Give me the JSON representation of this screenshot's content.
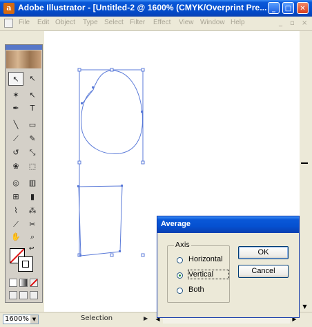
{
  "window": {
    "title": "Adobe Illustrator - [Untitled-2 @ 1600% (CMYK/Overprint Pre...",
    "app_icon": "illustrator-icon",
    "controls": {
      "minimize": "_",
      "maximize": "□",
      "close": "✕"
    }
  },
  "menubar": {
    "items": [
      "File",
      "Edit",
      "Object",
      "Type",
      "Select",
      "Filter",
      "Effect",
      "View",
      "Window",
      "Help"
    ],
    "mdi": {
      "minimize": "_",
      "restore": "▫",
      "close": "×"
    }
  },
  "toolbox": {
    "tools": [
      {
        "name": "selection-tool-icon",
        "glyph": "↖"
      },
      {
        "name": "direct-selection-tool-icon",
        "glyph": "↖"
      },
      {
        "name": "magic-wand-tool-icon",
        "glyph": "✶"
      },
      {
        "name": "lasso-tool-icon",
        "glyph": "↖"
      },
      {
        "name": "pen-tool-icon",
        "glyph": "✒"
      },
      {
        "name": "type-tool-icon",
        "glyph": "T"
      },
      {
        "name": "line-tool-icon",
        "glyph": "╲"
      },
      {
        "name": "rectangle-tool-icon",
        "glyph": "▭"
      },
      {
        "name": "paintbrush-tool-icon",
        "glyph": "⟋"
      },
      {
        "name": "pencil-tool-icon",
        "glyph": "✎"
      },
      {
        "name": "rotate-tool-icon",
        "glyph": "↺"
      },
      {
        "name": "scale-tool-icon",
        "glyph": "⤡"
      },
      {
        "name": "warp-tool-icon",
        "glyph": "❀"
      },
      {
        "name": "free-transform-tool-icon",
        "glyph": "⬚"
      },
      {
        "name": "symbol-sprayer-tool-icon",
        "glyph": "◎"
      },
      {
        "name": "graph-tool-icon",
        "glyph": "▥"
      },
      {
        "name": "mesh-tool-icon",
        "glyph": "⊞"
      },
      {
        "name": "gradient-tool-icon",
        "glyph": "▮"
      },
      {
        "name": "eyedropper-tool-icon",
        "glyph": "⌇"
      },
      {
        "name": "blend-tool-icon",
        "glyph": "⁂"
      },
      {
        "name": "slice-tool-icon",
        "glyph": "⟋"
      },
      {
        "name": "scissors-tool-icon",
        "glyph": "✂"
      },
      {
        "name": "hand-tool-icon",
        "glyph": "✋"
      },
      {
        "name": "zoom-tool-icon",
        "glyph": "⌕"
      }
    ]
  },
  "statusbar": {
    "zoom": "1600%",
    "zoom_arrow": "▼",
    "status": "Selection",
    "status_arrow": "▶",
    "left_arrow": "◀",
    "right_arrow": "▶"
  },
  "vscroll": {
    "up": "▲",
    "down": "▼"
  },
  "dialog": {
    "title": "Average",
    "axis_label": "Axis",
    "options": [
      "Horizontal",
      "Vertical",
      "Both"
    ],
    "selected": "Vertical",
    "ok": "OK",
    "cancel": "Cancel"
  },
  "colors": {
    "selection": "#5a7ad8",
    "titlebar": "#0550d0",
    "canvas": "#ffffff"
  }
}
